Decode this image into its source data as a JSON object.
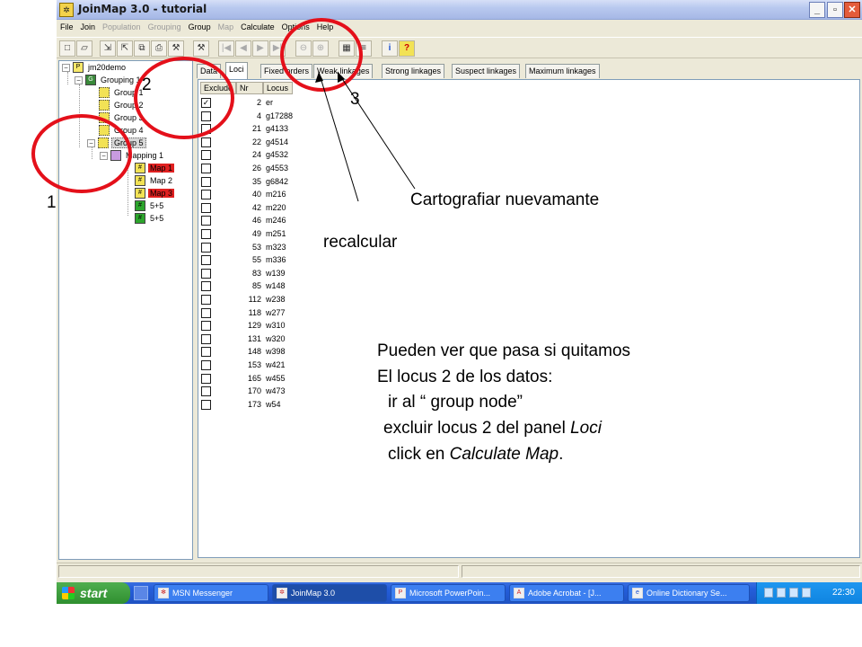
{
  "window": {
    "title": "JoinMap 3.0  - tutorial",
    "app_icon": "joinmap-app-icon",
    "buttons": [
      "_",
      "▫",
      "✕"
    ]
  },
  "menu": [
    {
      "label": "File",
      "enabled": true
    },
    {
      "label": "Join",
      "enabled": true
    },
    {
      "label": "Population",
      "enabled": false
    },
    {
      "label": "Grouping",
      "enabled": false
    },
    {
      "label": "Group",
      "enabled": true
    },
    {
      "label": "Map",
      "enabled": false
    },
    {
      "label": "Calculate",
      "enabled": true
    },
    {
      "label": "Options",
      "enabled": true
    },
    {
      "label": "Help",
      "enabled": true
    }
  ],
  "toolbar": {
    "icons": [
      "new-file-icon",
      "open-folder-icon",
      "import-icon",
      "export-icon",
      "copy-icon",
      "print-icon",
      "tools-icon",
      "hammer-icon",
      "first-icon",
      "prev-icon",
      "next-icon",
      "last-icon",
      "zoom-out-icon",
      "zoom-in-icon",
      "calculator-icon",
      "list-icon",
      "info-icon",
      "help-icon"
    ]
  },
  "tree": {
    "project": "jm20demo",
    "grouping": "Grouping 1",
    "groups": [
      "Group 1",
      "Group 2",
      "Group 3",
      "Group 4",
      "Group 5"
    ],
    "mapping": "Mapping 1",
    "maps": [
      "Map 1",
      "Map 2",
      "Map 3",
      "5+5",
      "5+5"
    ]
  },
  "tabs": [
    {
      "label": "Data",
      "active": false
    },
    {
      "label": "Loci",
      "active": true
    },
    {
      "label": "Fixed orders",
      "active": false
    },
    {
      "label": "Weak linkages",
      "active": false
    },
    {
      "label": "Strong linkages",
      "active": false
    },
    {
      "label": "Suspect linkages",
      "active": false
    },
    {
      "label": "Maximum linkages",
      "active": false
    }
  ],
  "loci_table": {
    "headers": [
      "Exclude",
      "Nr",
      "Locus"
    ],
    "rows": [
      {
        "exclude": true,
        "nr": "2",
        "locus": "er"
      },
      {
        "exclude": false,
        "nr": "4",
        "locus": "g17288"
      },
      {
        "exclude": false,
        "nr": "21",
        "locus": "g4133"
      },
      {
        "exclude": false,
        "nr": "22",
        "locus": "g4514"
      },
      {
        "exclude": false,
        "nr": "24",
        "locus": "g4532"
      },
      {
        "exclude": false,
        "nr": "26",
        "locus": "g4553"
      },
      {
        "exclude": false,
        "nr": "35",
        "locus": "g6842"
      },
      {
        "exclude": false,
        "nr": "40",
        "locus": "m216"
      },
      {
        "exclude": false,
        "nr": "42",
        "locus": "m220"
      },
      {
        "exclude": false,
        "nr": "46",
        "locus": "m246"
      },
      {
        "exclude": false,
        "nr": "49",
        "locus": "m251"
      },
      {
        "exclude": false,
        "nr": "53",
        "locus": "m323"
      },
      {
        "exclude": false,
        "nr": "55",
        "locus": "m336"
      },
      {
        "exclude": false,
        "nr": "83",
        "locus": "w139"
      },
      {
        "exclude": false,
        "nr": "85",
        "locus": "w148"
      },
      {
        "exclude": false,
        "nr": "112",
        "locus": "w238"
      },
      {
        "exclude": false,
        "nr": "118",
        "locus": "w277"
      },
      {
        "exclude": false,
        "nr": "129",
        "locus": "w310"
      },
      {
        "exclude": false,
        "nr": "131",
        "locus": "w320"
      },
      {
        "exclude": false,
        "nr": "148",
        "locus": "w398"
      },
      {
        "exclude": false,
        "nr": "153",
        "locus": "w421"
      },
      {
        "exclude": false,
        "nr": "165",
        "locus": "w455"
      },
      {
        "exclude": false,
        "nr": "170",
        "locus": "w473"
      },
      {
        "exclude": false,
        "nr": "173",
        "locus": "w54"
      }
    ]
  },
  "taskbar": {
    "start_label": "start",
    "tasks": [
      {
        "label": "MSN Messenger",
        "icon": "msn-icon",
        "active": false
      },
      {
        "label": "JoinMap 3.0",
        "icon": "joinmap-icon",
        "active": true
      },
      {
        "label": "Microsoft PowerPoin...",
        "icon": "powerpoint-icon",
        "active": false
      },
      {
        "label": "Adobe Acrobat - [J...",
        "icon": "acrobat-icon",
        "active": false
      },
      {
        "label": "Online Dictionary Se...",
        "icon": "ie-icon",
        "active": false
      }
    ],
    "clock": "22:30"
  },
  "annotations": {
    "marker_1": "1",
    "marker_2": "2",
    "marker_3": "3",
    "remap_label": "Cartografiar nuevamante",
    "recalc_label": "recalcular",
    "instructions": [
      "Pueden ver que pasa si quitamos",
      "El locus 2  de los datos:",
      "ir al “ group node”",
      "excluir locus 2 del panel Loci",
      "click en Calculate Map."
    ],
    "annotation_color": "#e4101a"
  }
}
